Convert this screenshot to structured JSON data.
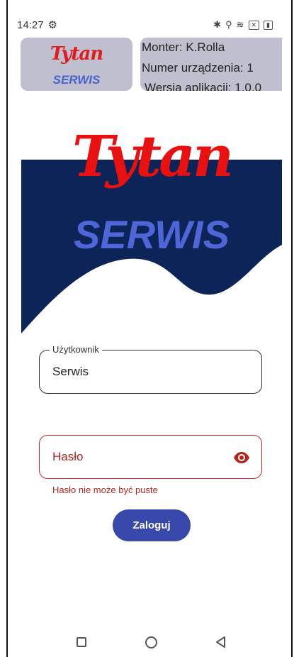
{
  "status": {
    "time": "14:27"
  },
  "header": {
    "brand": "Tytan",
    "sub": "SERWIS"
  },
  "info": {
    "monter": "Monter: K.Rolla",
    "device": "Numer urządzenia: 1",
    "version": "Wersja aplikacji: 1.0.0"
  },
  "hero": {
    "brand": "Tytan",
    "sub": "SERWIS",
    "colors": {
      "brand_red": "#e81010",
      "navy": "#0d2458",
      "serwis_blue": "#4f66d8"
    }
  },
  "form": {
    "user_label": "Użytkownik",
    "user_value": "Serwis",
    "password_placeholder": "Hasło",
    "password_error": "Hasło nie może być puste",
    "login_label": "Zaloguj"
  },
  "colors": {
    "accent": "#3948ab",
    "error": "#b3261e",
    "panel": "#bfbfcf"
  }
}
